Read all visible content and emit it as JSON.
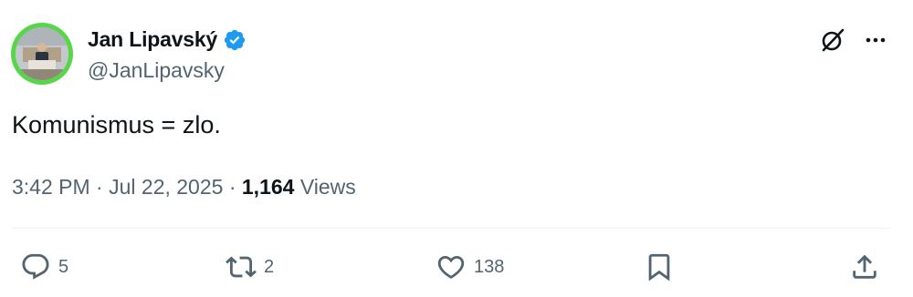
{
  "author": {
    "name": "Jan Lipavský",
    "handle": "@JanLipavsky",
    "verified": true,
    "avatar_ring_color": "#58d64a",
    "verified_color": "#1d9bf0"
  },
  "tweet": {
    "text": "Komunismus = zlo.",
    "time": "3:42 PM",
    "separator": " · ",
    "date": "Jul 22, 2025",
    "views_count": "1,164",
    "views_label": "Views"
  },
  "actions": {
    "replies": "5",
    "reposts": "2",
    "likes": "138"
  },
  "icons": {
    "top_right": [
      "grok-icon",
      "more-icon"
    ],
    "actions": [
      "reply-icon",
      "repost-icon",
      "like-icon",
      "bookmark-icon",
      "share-icon"
    ]
  }
}
